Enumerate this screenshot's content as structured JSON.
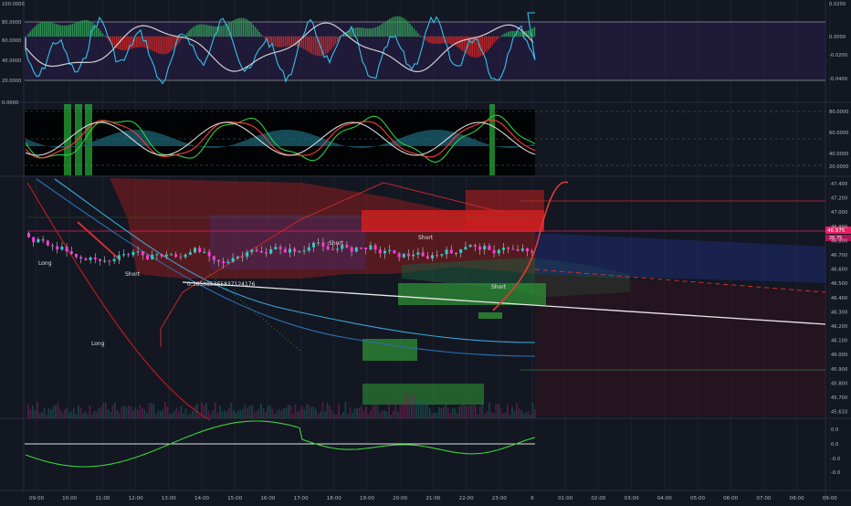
{
  "chart_data": [
    {
      "type": "line",
      "panel": "oscillator-top",
      "left_scale_ticks": [
        "100.0000",
        "80.0000",
        "60.0000",
        "40.0000",
        "20.0000"
      ],
      "right_scale_ticks": [
        "0.0200",
        "0.0000",
        "-0.0200",
        "-0.0400"
      ],
      "overbought_level": 80,
      "oversold_level": 20,
      "colors": {
        "cyan": "#33c3e8",
        "white": "#d0d0d0",
        "hist_up": "#2e9b53",
        "hist_down": "#c62828",
        "hist_blue": "#2a3aa8",
        "fill": "#2a1e4a"
      }
    },
    {
      "type": "line",
      "panel": "wave-trend",
      "left_scale_ticks": [
        "0.0000"
      ],
      "right_scale_ticks": [
        "80.0000",
        "60.0000",
        "40.0000",
        "20.0000"
      ],
      "colors": {
        "green": "#2ecc40",
        "red": "#ff3b3b",
        "white": "#d9d9d9",
        "teal": "#1e6a7a"
      }
    },
    {
      "type": "candlestick",
      "panel": "price",
      "price_ticks": [
        "47.400",
        "47.200",
        "47.000",
        "46.900",
        "46.800",
        "46.700",
        "46.600",
        "46.500",
        "46.400",
        "46.300",
        "46.200",
        "46.100",
        "46.000",
        "45.900",
        "45.800",
        "45.700",
        "45.610"
      ],
      "current_price_labels": [
        "46.975",
        "26.75"
      ],
      "annotations": [
        "Long",
        "Short",
        "Short",
        "Short",
        "Short",
        "Long",
        "0.385085365837124176"
      ],
      "colors": {
        "up": "#22d3c5",
        "down": "#ff3ad9",
        "cloud_red": "#8a1d1d",
        "cloud_green": "#1f5a3a",
        "zone_red": "#d01f1f",
        "zone_green": "#2f8f35",
        "trend_white": "#e8e8e8",
        "price_line": "#e91e63"
      }
    },
    {
      "type": "line",
      "panel": "momentum-bottom",
      "right_scale_ticks": [
        "0.0",
        "0.0",
        "-0.0",
        "-0.0"
      ],
      "zero_level": 0,
      "colors": {
        "line": "#39d23a",
        "zero": "#e0e0e0"
      }
    }
  ],
  "time_axis": [
    "09:00",
    "10:00",
    "11:00",
    "12:00",
    "13:00",
    "14:00",
    "15:00",
    "16:00",
    "17:00",
    "18:00",
    "19:00",
    "20:00",
    "21:00",
    "22:00",
    "23:00",
    "6",
    "01:00",
    "02:00",
    "03:00",
    "04:00",
    "05:00",
    "06:00",
    "07:00",
    "08:00",
    "09:00"
  ]
}
